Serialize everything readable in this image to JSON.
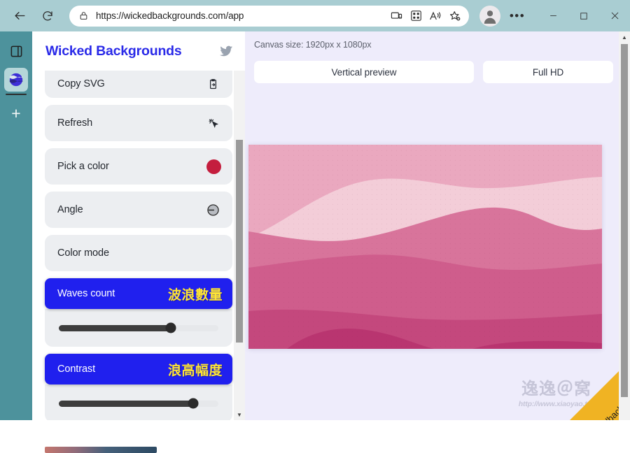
{
  "browser": {
    "url": "https://wickedbackgrounds.com/app",
    "back_icon": "back-arrow-icon",
    "reload_icon": "reload-icon",
    "lock_icon": "site-info-lock-icon",
    "toolbar_icons": [
      "cast-device-icon",
      "qr-code-icon",
      "read-aloud-icon",
      "add-favorite-icon"
    ],
    "profile_icon": "profile-avatar-icon",
    "more_label": "•••",
    "minimize_label": "─",
    "maximize_label": "☐",
    "close_label": "✕"
  },
  "tab_rail": {
    "collections_icon": "vertical-tabs-icon",
    "active_tab_icon": "wicked-backgrounds-favicon",
    "new_tab_label": "+"
  },
  "app": {
    "title": "Wicked Backgrounds",
    "title_color": "#2a2ae8",
    "social_icon": "twitter-icon"
  },
  "controls": [
    {
      "label": "Copy SVG",
      "icon": "clipboard-copy-icon",
      "type": "action"
    },
    {
      "label": "Refresh",
      "icon": "sparkle-cursor-icon",
      "type": "action"
    },
    {
      "label": "Pick a color",
      "icon": "color-swatch-icon",
      "color": "#c41e3e",
      "type": "color"
    },
    {
      "label": "Angle",
      "icon": "angle-dial-icon",
      "type": "action"
    },
    {
      "label": "Color mode",
      "icon": "",
      "type": "action"
    }
  ],
  "annotated_controls": [
    {
      "label": "Waves count",
      "annotation": "波浪數量",
      "highlight_color": "#2020ee",
      "annotation_color": "#ffe534",
      "slider_percent": 70
    },
    {
      "label": "Contrast",
      "annotation": "浪高幅度",
      "highlight_color": "#2020ee",
      "annotation_color": "#ffe534",
      "slider_percent": 84
    }
  ],
  "canvas": {
    "size_label": "Canvas size: 1920px x 1080px",
    "presets": [
      {
        "label": "Vertical preview"
      },
      {
        "label": "Full HD"
      }
    ],
    "wave_colors": [
      "#f3cdd8",
      "#eaa8bf",
      "#e292ad",
      "#d8749b",
      "#cf5d8c",
      "#c4487d",
      "#b93570"
    ]
  },
  "watermark": {
    "logo": "逸逸＠窝",
    "url": "http://www.xiaoyao.tw/"
  },
  "feedback": {
    "label": "Feedback",
    "color": "#f0b323"
  },
  "scrollbars": {
    "up_arrow": "▲",
    "down_arrow": "▼"
  }
}
